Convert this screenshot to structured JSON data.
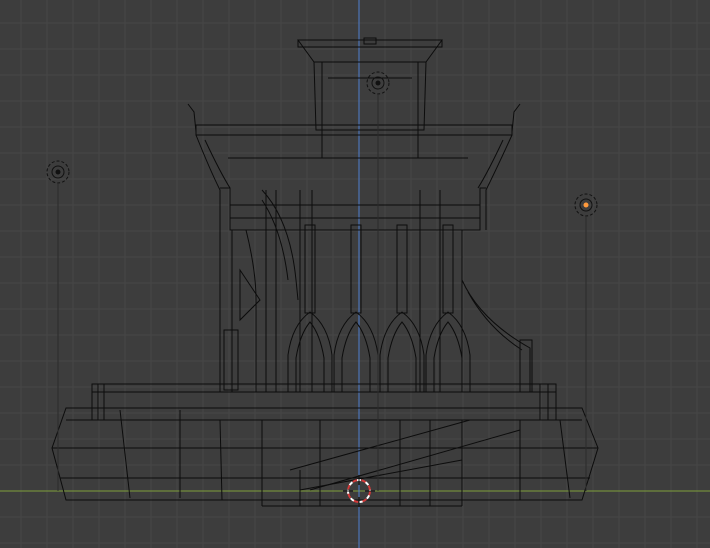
{
  "app": {
    "view": "3D Viewport",
    "shading": "wireframe",
    "view_orientation": "front-orthographic"
  },
  "colors": {
    "background": "#3d3d3d",
    "grid_minor": "#474747",
    "grid_major": "#4f4f4f",
    "axis_x": "#7fa03a",
    "axis_z": "#4f7fd0",
    "wire": "#0c0c0c",
    "cursor_red": "#d33a3a",
    "cursor_white": "#ffffff",
    "object_origin_active": "#ff9a3c"
  },
  "scene": {
    "model": "tower-structure",
    "empties": [
      "lamp-left",
      "lamp-top",
      "lamp-right"
    ],
    "cursor_visible": true
  }
}
